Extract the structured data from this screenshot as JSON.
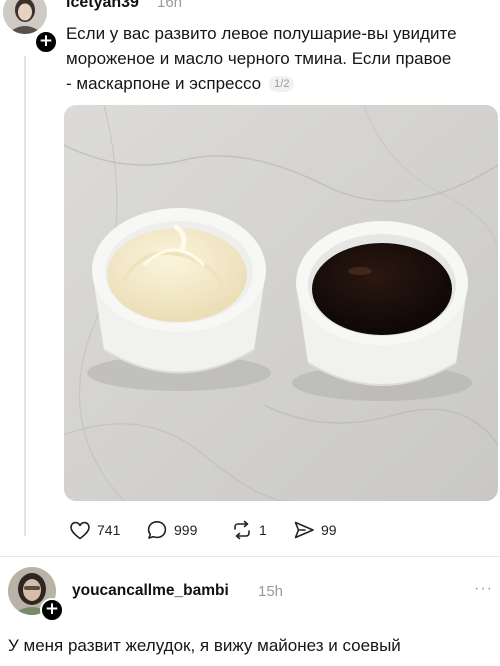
{
  "post": {
    "username": "icetyan39",
    "time": "16h",
    "text_lines": [
      "Если у вас развито левое полушарие-вы увидите",
      "мороженое и масло черного тмина. Если правое",
      "- маскарпоне и эспрессо"
    ],
    "page_indicator": "1/2",
    "image_icon": "photo-two-ramekins-cream-and-dark-liquid",
    "actions": {
      "likes": "741",
      "replies": "999",
      "reposts": "1",
      "shares": "99"
    }
  },
  "reply": {
    "username": "youcancallme_bambi",
    "time": "15h",
    "more_icon": "···",
    "text": "У меня развит желудок, я вижу майонез и соевый"
  },
  "colors": {
    "text": "#161616",
    "muted": "#9a9a9a",
    "divider": "#e6e6e6",
    "badge": "#000000"
  }
}
